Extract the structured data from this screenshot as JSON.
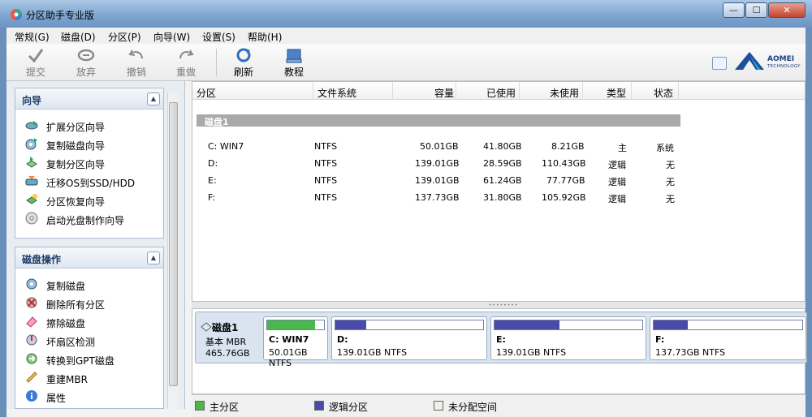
{
  "window": {
    "title": "分区助手专业版",
    "minimize": "—",
    "maximize": "☐",
    "close": "✕"
  },
  "menu": [
    "常规(G)",
    "磁盘(D)",
    "分区(P)",
    "向导(W)",
    "设置(S)",
    "帮助(H)"
  ],
  "toolbar": {
    "commit": "提交",
    "discard": "放弃",
    "undo": "撤销",
    "redo": "重做",
    "refresh": "刷新",
    "tutorial": "教程",
    "logo_main": "AOMEI",
    "logo_sub": "TECHNOLOGY"
  },
  "wizard_group": {
    "title": "向导",
    "items": [
      "扩展分区向导",
      "复制磁盘向导",
      "复制分区向导",
      "迁移OS到SSD/HDD",
      "分区恢复向导",
      "启动光盘制作向导"
    ]
  },
  "disk_ops_group": {
    "title": "磁盘操作",
    "items": [
      "复制磁盘",
      "删除所有分区",
      "擦除磁盘",
      "坏扇区检测",
      "转换到GPT磁盘",
      "重建MBR",
      "属性"
    ]
  },
  "table": {
    "headers": {
      "partition": "分区",
      "filesystem": "文件系统",
      "capacity": "容量",
      "used": "已使用",
      "unused": "未使用",
      "type": "类型",
      "status": "状态"
    },
    "disk_label": "磁盘1",
    "rows": [
      {
        "partition": "C: WIN7",
        "fs": "NTFS",
        "capacity": "50.01GB",
        "used": "41.80GB",
        "unused": "8.21GB",
        "type": "主",
        "status": "系统"
      },
      {
        "partition": "D:",
        "fs": "NTFS",
        "capacity": "139.01GB",
        "used": "28.59GB",
        "unused": "110.43GB",
        "type": "逻辑",
        "status": "无"
      },
      {
        "partition": "E:",
        "fs": "NTFS",
        "capacity": "139.01GB",
        "used": "61.24GB",
        "unused": "77.77GB",
        "type": "逻辑",
        "status": "无"
      },
      {
        "partition": "F:",
        "fs": "NTFS",
        "capacity": "137.73GB",
        "used": "31.80GB",
        "unused": "105.92GB",
        "type": "逻辑",
        "status": "无"
      }
    ]
  },
  "diskmap": {
    "disk_name": "磁盘1",
    "disk_type": "基本 MBR",
    "disk_size": "465.76GB",
    "partitions": [
      {
        "name": "C: WIN7",
        "size": "50.01GB NTFS",
        "used_fraction": 0.84,
        "color": "#4bb84b"
      },
      {
        "name": "D:",
        "size": "139.01GB NTFS",
        "used_fraction": 0.21,
        "color": "#4a4aa8"
      },
      {
        "name": "E:",
        "size": "139.01GB NTFS",
        "used_fraction": 0.44,
        "color": "#4a4aa8"
      },
      {
        "name": "F:",
        "size": "137.73GB NTFS",
        "used_fraction": 0.23,
        "color": "#4a4aa8"
      }
    ]
  },
  "legend": {
    "primary": "主分区",
    "logical": "逻辑分区",
    "unallocated": "未分配空间"
  },
  "colors": {
    "primary": "#4bb84b",
    "logical": "#4a4aa8",
    "unallocated": "#f2efe6"
  }
}
